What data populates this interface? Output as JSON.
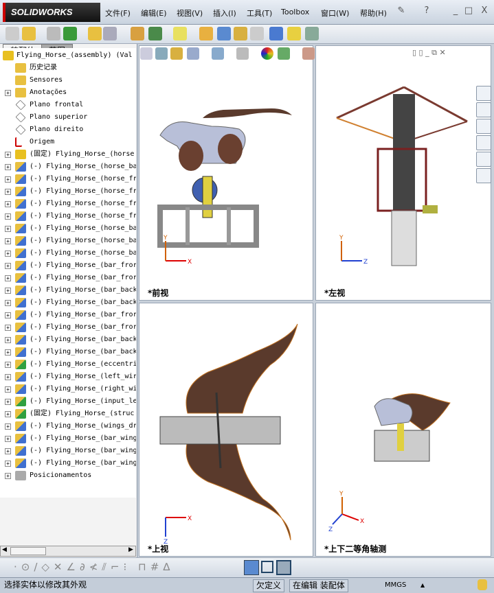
{
  "app": {
    "logo": "SOLIDWORKS"
  },
  "menu": [
    "文件(F)",
    "编辑(E)",
    "视图(V)",
    "插入(I)",
    "工具(T)",
    "Toolbox",
    "窗口(W)",
    "帮助(H)"
  ],
  "window_controls": {
    "help": "?",
    "minimize": "_",
    "restore": "□",
    "close": "X"
  },
  "panel": {
    "tabs": [
      "装配体",
      "草图"
    ],
    "more": "»",
    "filter": "▼"
  },
  "tree": [
    {
      "label": "Flying_Horse_(assembly)  (Val",
      "expand": false,
      "icon": "assembly"
    },
    {
      "label": "历史记录",
      "expand": false,
      "icon": "history"
    },
    {
      "label": "Sensores",
      "expand": false,
      "icon": "sensor"
    },
    {
      "label": "Anotações",
      "expand": true,
      "icon": "annotation"
    },
    {
      "label": "Plano frontal",
      "expand": false,
      "icon": "plane"
    },
    {
      "label": "Plano superior",
      "expand": false,
      "icon": "plane"
    },
    {
      "label": "Plano direito",
      "expand": false,
      "icon": "plane"
    },
    {
      "label": "Origem",
      "expand": false,
      "icon": "origin"
    },
    {
      "label": "(固定) Flying_Horse_(horse",
      "expand": true,
      "icon": "subassembly"
    },
    {
      "label": "(-) Flying_Horse_(horse_ba",
      "expand": true,
      "icon": "part"
    },
    {
      "label": "(-) Flying_Horse_(horse_fr",
      "expand": true,
      "icon": "part"
    },
    {
      "label": "(-) Flying_Horse_(horse_fr",
      "expand": true,
      "icon": "part"
    },
    {
      "label": "(-) Flying_Horse_(horse_fr",
      "expand": true,
      "icon": "part"
    },
    {
      "label": "(-) Flying_Horse_(horse_fr",
      "expand": true,
      "icon": "part"
    },
    {
      "label": "(-) Flying_Horse_(horse_ba",
      "expand": true,
      "icon": "part"
    },
    {
      "label": "(-) Flying_Horse_(horse_ba",
      "expand": true,
      "icon": "part"
    },
    {
      "label": "(-) Flying_Horse_(horse_ba",
      "expand": true,
      "icon": "part"
    },
    {
      "label": "(-) Flying_Horse_(bar_fror",
      "expand": true,
      "icon": "part"
    },
    {
      "label": "(-) Flying_Horse_(bar_fror",
      "expand": true,
      "icon": "part"
    },
    {
      "label": "(-) Flying_Horse_(bar_back",
      "expand": true,
      "icon": "part"
    },
    {
      "label": "(-) Flying_Horse_(bar_back",
      "expand": true,
      "icon": "part"
    },
    {
      "label": "(-) Flying_Horse_(bar_fror",
      "expand": true,
      "icon": "part"
    },
    {
      "label": "(-) Flying_Horse_(bar_fror",
      "expand": true,
      "icon": "part"
    },
    {
      "label": "(-) Flying_Horse_(bar_back",
      "expand": true,
      "icon": "part"
    },
    {
      "label": "(-) Flying_Horse_(bar_back",
      "expand": true,
      "icon": "part"
    },
    {
      "label": "(-) Flying_Horse_(eccentri",
      "expand": true,
      "icon": "part-green"
    },
    {
      "label": "(-) Flying_Horse_(left_wir",
      "expand": true,
      "icon": "part"
    },
    {
      "label": "(-) Flying_Horse_(right_wi",
      "expand": true,
      "icon": "part"
    },
    {
      "label": "(-) Flying_Horse_(input_le",
      "expand": true,
      "icon": "part-green"
    },
    {
      "label": "(固定) Flying_Horse_(struc",
      "expand": true,
      "icon": "part-green"
    },
    {
      "label": "(-) Flying_Horse_(wings_dr",
      "expand": true,
      "icon": "part"
    },
    {
      "label": "(-) Flying_Horse_(bar_wing",
      "expand": true,
      "icon": "part"
    },
    {
      "label": "(-) Flying_Horse_(bar_wing",
      "expand": true,
      "icon": "part"
    },
    {
      "label": "(-) Flying_Horse_(bar_wing",
      "expand": true,
      "icon": "part"
    },
    {
      "label": "Posicionamentos",
      "expand": true,
      "icon": "mates"
    }
  ],
  "viewports": [
    {
      "label": "*前视",
      "axes": [
        "Y",
        "X"
      ]
    },
    {
      "label": "*左视",
      "axes": [
        "Y",
        "Z"
      ]
    },
    {
      "label": "*上视",
      "axes": [
        "X",
        "Z"
      ]
    },
    {
      "label": "*上下二等角轴测",
      "axes": [
        "Y",
        "X",
        "Z"
      ]
    }
  ],
  "status": {
    "message": "选择实体以修改其外观",
    "state": "欠定义",
    "mode": "在编辑 装配体",
    "units": "MMGS",
    "units_arrow": "▲"
  },
  "colors": {
    "wing": "#5a3a2c",
    "frame": "#c8c8c8",
    "horse": "#b8bfd8",
    "axis_x": "#d00000",
    "axis_y": "#d06000",
    "axis_z": "#2040d0"
  }
}
